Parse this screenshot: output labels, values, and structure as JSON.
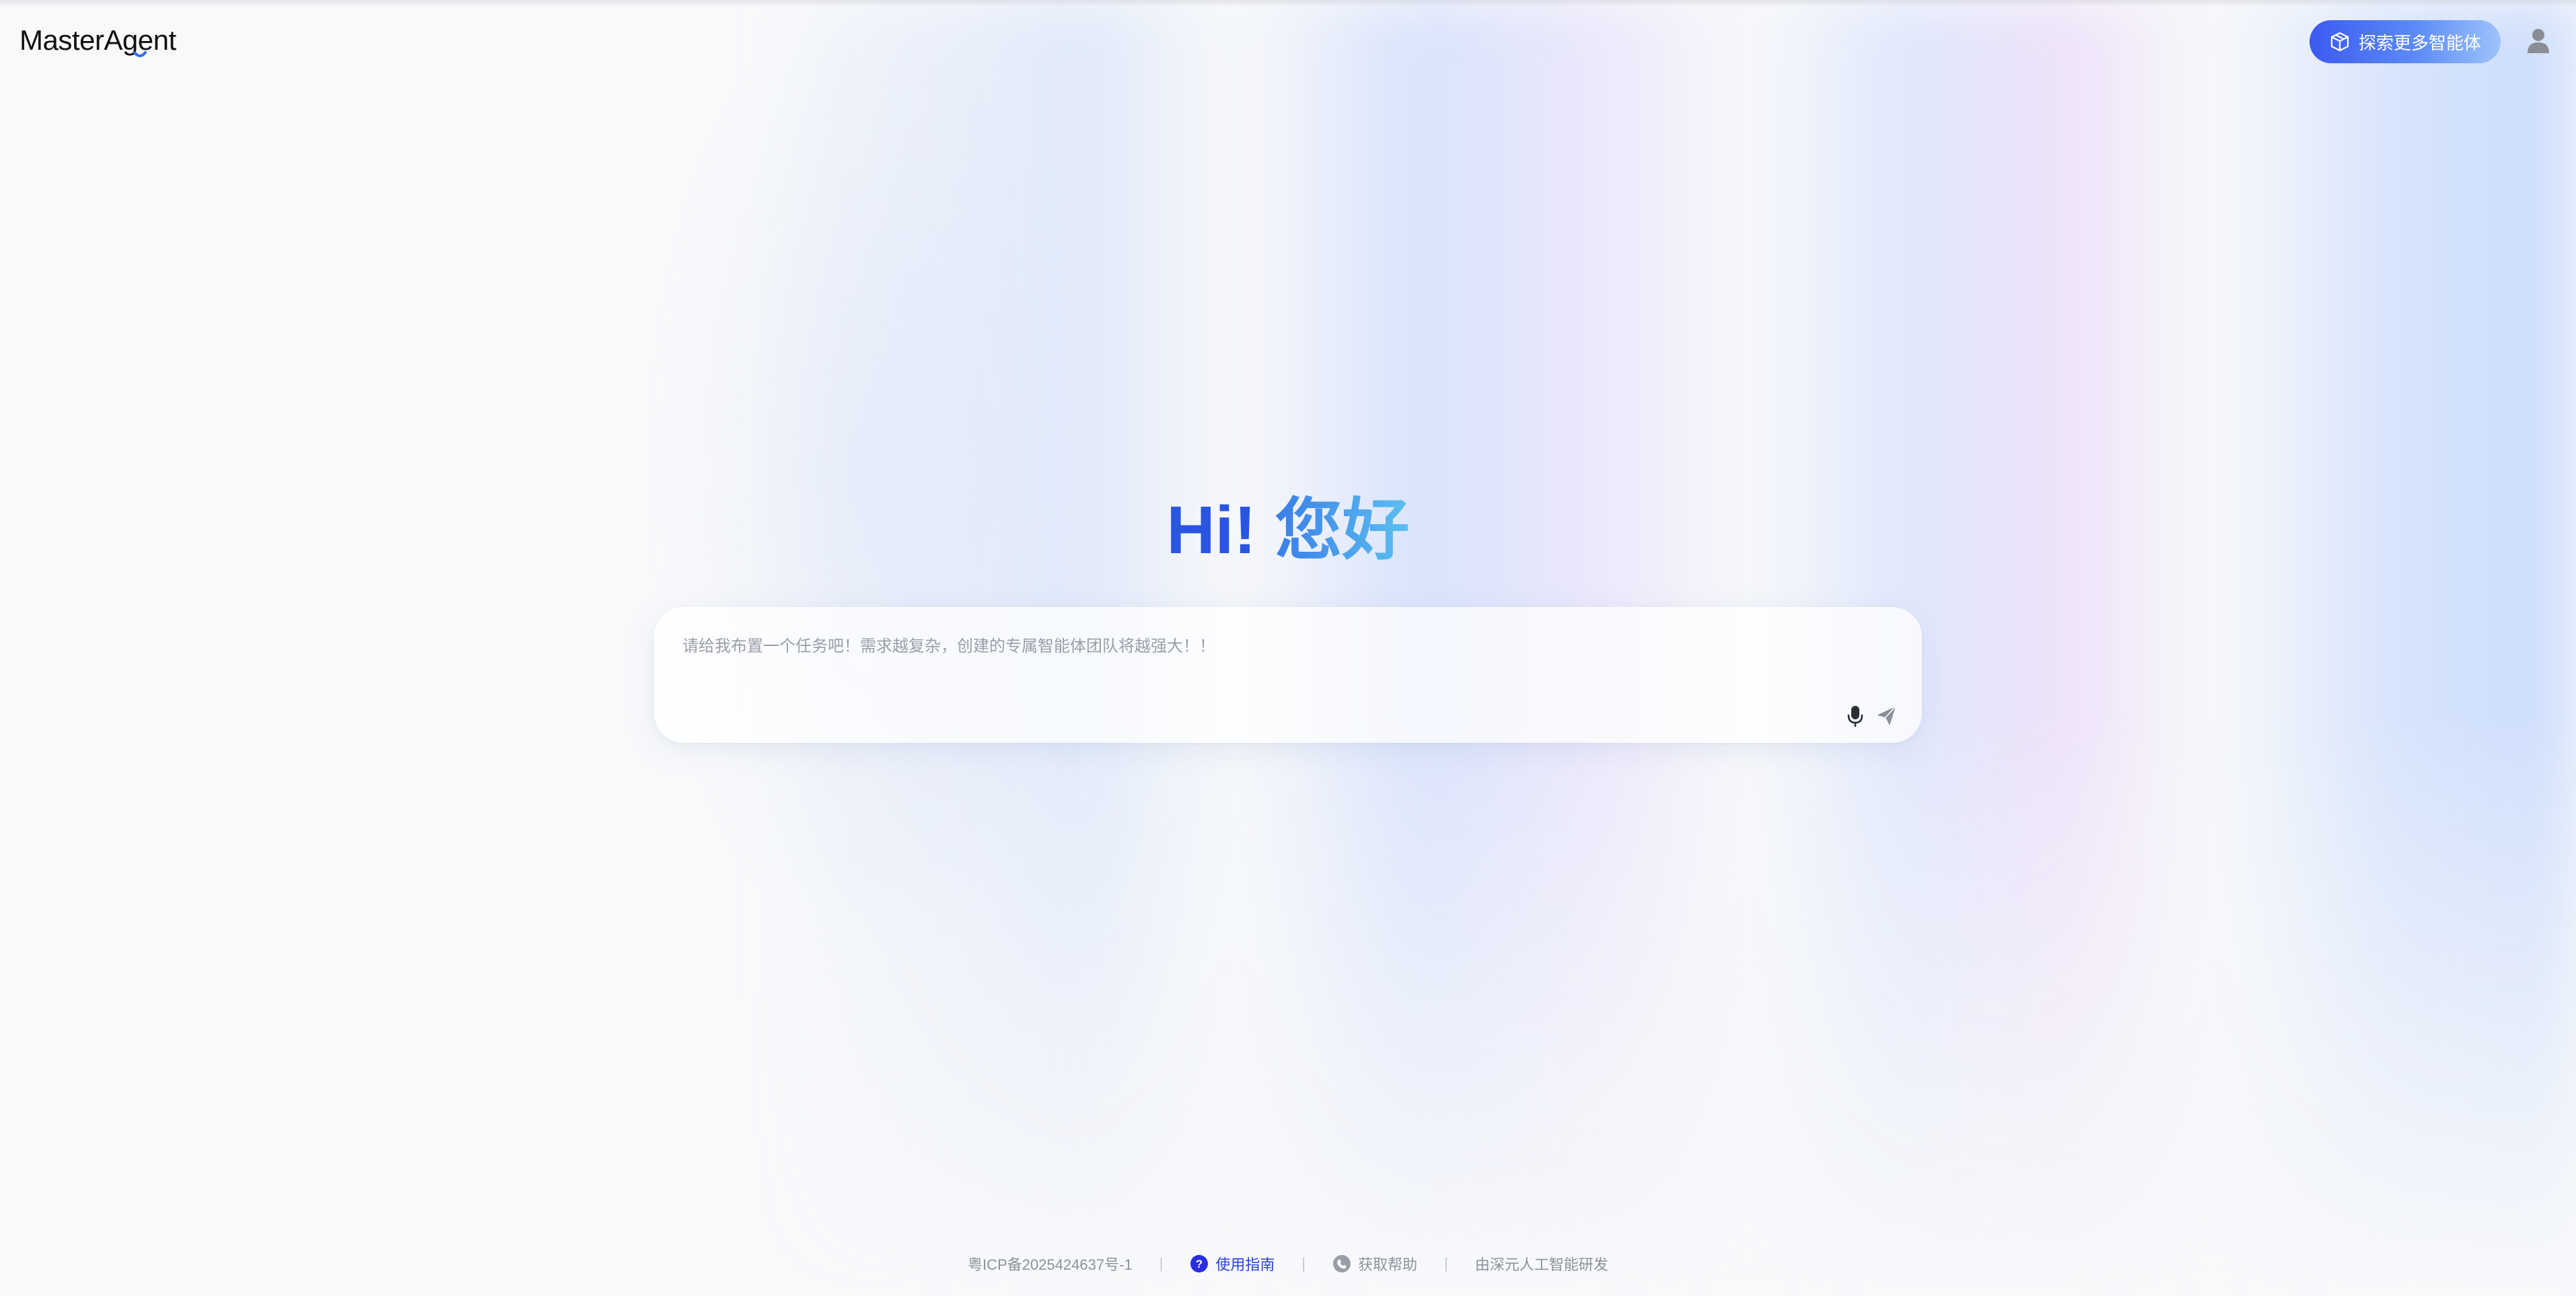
{
  "header": {
    "logo_text": "MasterAgent",
    "explore_button_label": "探索更多智能体",
    "user_icon": "user-icon"
  },
  "main": {
    "greeting_hi": "Hi!",
    "greeting_hello": "您好",
    "input_placeholder": "请给我布置一个任务吧！需求越复杂，创建的专属智能体团队将越强大！！",
    "mic_icon": "microphone-icon",
    "send_icon": "send-icon"
  },
  "footer": {
    "icp": "粤ICP备2025424637号-1",
    "guide_label": "使用指南",
    "help_label": "获取帮助",
    "credit": "由深元人工智能研发",
    "separator": "|"
  },
  "colors": {
    "brand_blue": "#2a55e0",
    "greeting_gradient_end": "#5cc0f0",
    "guide_link": "#2a40d8"
  }
}
